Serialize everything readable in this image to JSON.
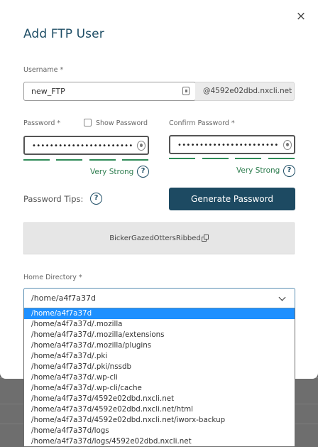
{
  "dialog": {
    "title": "Add FTP User",
    "close_glyph": "×"
  },
  "username": {
    "label": "Username *",
    "value": "new_FTP",
    "domain_suffix": "@4592e02dbd.nxcli.net"
  },
  "password": {
    "label": "Password *",
    "show_label": "Show Password",
    "value": "•••••••••••••••••••••••",
    "strength": "Very Strong"
  },
  "confirm_password": {
    "label": "Confirm Password *",
    "value": "•••••••••••••••••••••••",
    "strength": "Very Strong"
  },
  "tips": {
    "label": "Password Tips:",
    "help_glyph": "?"
  },
  "generate_button": {
    "label": "Generate Password"
  },
  "suggestion": {
    "text": "BickerGazedOttersRibbed"
  },
  "home_directory": {
    "label": "Home Directory *",
    "selected": "/home/a4f7a37d",
    "options": [
      "/home/a4f7a37d",
      "/home/a4f7a37d/.mozilla",
      "/home/a4f7a37d/.mozilla/extensions",
      "/home/a4f7a37d/.mozilla/plugins",
      "/home/a4f7a37d/.pki",
      "/home/a4f7a37d/.pki/nssdb",
      "/home/a4f7a37d/.wp-cli",
      "/home/a4f7a37d/.wp-cli/cache",
      "/home/a4f7a37d/4592e02dbd.nxcli.net",
      "/home/a4f7a37d/4592e02dbd.nxcli.net/html",
      "/home/a4f7a37d/4592e02dbd.nxcli.net/iworx-backup",
      "/home/a4f7a37d/logs",
      "/home/a4f7a37d/logs/4592e02dbd.nxcli.net"
    ]
  },
  "colors": {
    "primary": "#1d4a62",
    "strength_green": "#2e8b57",
    "dropdown_highlight": "#1e90ff"
  },
  "icons": {
    "close": "close-icon",
    "username_field": "contact-card-icon",
    "password_reveal": "eye-icon",
    "help": "help-circle-icon",
    "copy": "copy-icon",
    "dropdown": "chevron-down-icon"
  }
}
